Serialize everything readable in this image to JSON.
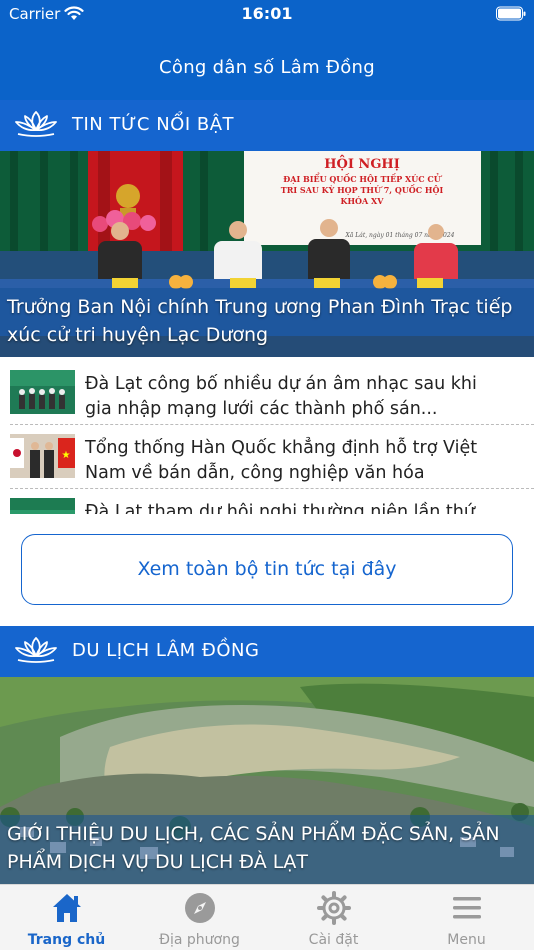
{
  "status_bar": {
    "carrier": "Carrier",
    "time": "16:01"
  },
  "header": {
    "title": "Công dân số Lâm Đồng"
  },
  "featured_news": {
    "section_title": "TIN TỨC NỔI BẬT",
    "hero_caption": "Trưởng Ban Nội chính Trung ương Phan Đình Trạc tiếp xúc cử tri huyện Lạc Dương",
    "hero_banner": {
      "line1": "HỘI NGHỊ",
      "line2": "ĐẠI BIỂU QUỐC HỘI TIẾP XÚC CỬ",
      "line3": "TRI SAU KỲ HỌP THỨ 7, QUỐC HỘI",
      "line4": "KHÓA XV",
      "date": "Xã Lát, ngày 01 tháng 07 năm 2024"
    },
    "items": [
      {
        "title": "Đà Lạt công bố nhiều dự án âm nhạc sau khi gia nhập mạng lưới các thành phố sán..."
      },
      {
        "title": "Tổng thống Hàn Quốc khẳng định hỗ trợ Việt Nam về bán dẫn, công nghiệp văn hóa"
      },
      {
        "title": "Đà Lạt tham dự hội nghị thường niên lần thứ"
      }
    ],
    "view_all_label": "Xem toàn bộ tin tức tại đây"
  },
  "tourism": {
    "section_title": "DU LỊCH LÂM ĐỒNG",
    "hero_caption": "GIỚI THIỆU DU LỊCH, CÁC SẢN PHẨM ĐẶC SẢN, SẢN PHẨM DỊCH VỤ DU LỊCH ĐÀ LẠT"
  },
  "tab_bar": {
    "tabs": [
      {
        "label": "Trang chủ",
        "icon": "home-icon",
        "active": true
      },
      {
        "label": "Địa phương",
        "icon": "compass-icon",
        "active": false
      },
      {
        "label": "Cài đặt",
        "icon": "gear-icon",
        "active": false
      },
      {
        "label": "Menu",
        "icon": "menu-icon",
        "active": false
      }
    ]
  },
  "colors": {
    "primary": "#0b63c9",
    "accent": "#1565cf",
    "tab_active": "#1a66c9",
    "tab_inactive": "#999999"
  }
}
